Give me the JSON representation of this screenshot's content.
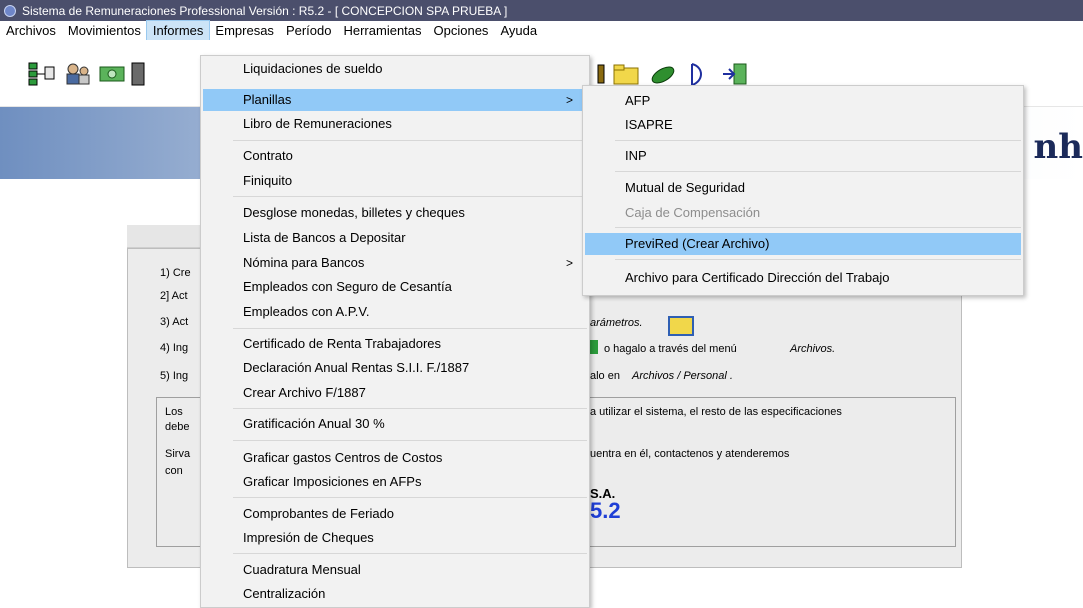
{
  "window": {
    "title": "Sistema de Remuneraciones Professional Versión : R5.2  - [ CONCEPCION SPA PRUEBA ]"
  },
  "menubar": {
    "items": [
      "Archivos",
      "Movimientos",
      "Informes",
      "Empresas",
      "Período",
      "Herramientas",
      "Opciones",
      "Ayuda"
    ],
    "active": "Informes"
  },
  "banner": {
    "text": "nh"
  },
  "background_panel": {
    "steps": [
      "1) Cre",
      "2] Act",
      "3) Act",
      "4) Ing",
      "5) Ing"
    ],
    "fragments": {
      "f1": "arámetros.",
      "f2": "o hagalo a través del menú",
      "f2b": "Archivos.",
      "f3": "alo en",
      "f3b": "Archivos / Personal .",
      "f4": "a utilizar el sistema, el resto de las especificaciones",
      "f5": "uentra en él,  contactenos y atenderemos",
      "f6": "S.A.",
      "f7": "5.2",
      "in1": "Los",
      "in2": "debe",
      "in3": "Sirva",
      "in4": "con"
    }
  },
  "informes_menu": {
    "items": [
      "Liquidaciones de sueldo",
      "Planillas",
      "Libro de Remuneraciones",
      "Contrato",
      "Finiquito",
      "Desglose monedas, billetes y cheques",
      "Lista de Bancos a Depositar",
      "Nómina para Bancos",
      "Empleados con Seguro de Cesantía",
      "Empleados con A.P.V.",
      "Certificado de Renta Trabajadores",
      "Declaración Anual Rentas S.I.I. F./1887",
      "Crear Archivo F/1887",
      "Gratificación Anual 30 %",
      "Graficar gastos Centros de Costos",
      "Graficar Imposiciones en AFPs",
      "Comprobantes de Feriado",
      "Impresión de Cheques",
      "Cuadratura Mensual",
      "Centralización"
    ],
    "submenu_arrow": ">"
  },
  "planillas_submenu": {
    "items": [
      "AFP",
      "ISAPRE",
      "INP",
      "Mutual de Seguridad",
      "Caja de Compensación",
      "PreviRed (Crear Archivo)",
      "Archivo para Certificado Dirección del Trabajo"
    ]
  },
  "colors": {
    "titlebar": "#4b4f6c",
    "menu_highlight": "#91c9f7",
    "menubar_active": "#cce4f7",
    "disabled_text": "#8d8d8d",
    "version_blue": "#1f3fd6"
  },
  "toolbar_icons": [
    "org-chart-icon",
    "people-icon",
    "money-icon",
    "calculator-icon",
    "person-icon",
    "folder-icon",
    "satellite-icon",
    "door-icon",
    "exit-icon"
  ]
}
